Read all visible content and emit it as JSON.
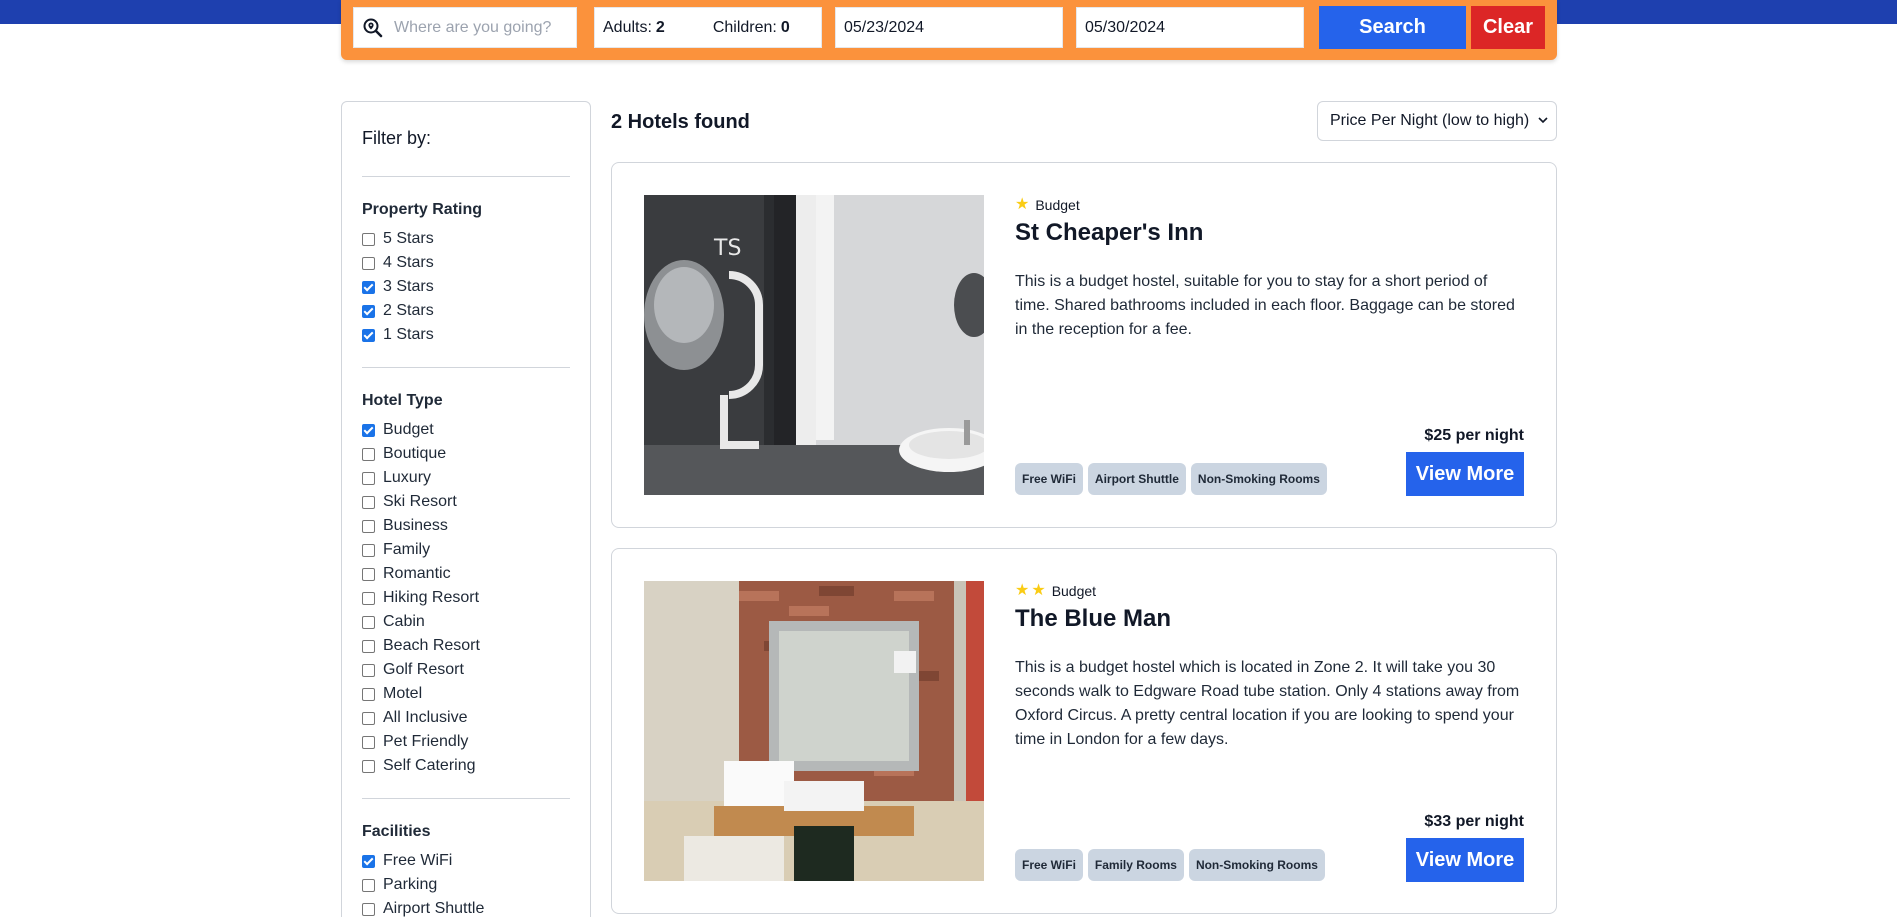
{
  "search": {
    "destination_placeholder": "Where are you going?",
    "adults_label": "Adults:",
    "adults_value": "2",
    "children_label": "Children:",
    "children_value": "0",
    "checkin": "05/23/2024",
    "checkout": "05/30/2024",
    "search_label": "Search",
    "clear_label": "Clear"
  },
  "filters": {
    "title": "Filter by:",
    "property_rating": {
      "title": "Property Rating",
      "options": [
        {
          "label": "5 Stars",
          "checked": false
        },
        {
          "label": "4 Stars",
          "checked": false
        },
        {
          "label": "3 Stars",
          "checked": true
        },
        {
          "label": "2 Stars",
          "checked": true
        },
        {
          "label": "1 Stars",
          "checked": true
        }
      ]
    },
    "hotel_type": {
      "title": "Hotel Type",
      "options": [
        {
          "label": "Budget",
          "checked": true
        },
        {
          "label": "Boutique",
          "checked": false
        },
        {
          "label": "Luxury",
          "checked": false
        },
        {
          "label": "Ski Resort",
          "checked": false
        },
        {
          "label": "Business",
          "checked": false
        },
        {
          "label": "Family",
          "checked": false
        },
        {
          "label": "Romantic",
          "checked": false
        },
        {
          "label": "Hiking Resort",
          "checked": false
        },
        {
          "label": "Cabin",
          "checked": false
        },
        {
          "label": "Beach Resort",
          "checked": false
        },
        {
          "label": "Golf Resort",
          "checked": false
        },
        {
          "label": "Motel",
          "checked": false
        },
        {
          "label": "All Inclusive",
          "checked": false
        },
        {
          "label": "Pet Friendly",
          "checked": false
        },
        {
          "label": "Self Catering",
          "checked": false
        }
      ]
    },
    "facilities": {
      "title": "Facilities",
      "options": [
        {
          "label": "Free WiFi",
          "checked": true
        },
        {
          "label": "Parking",
          "checked": false
        },
        {
          "label": "Airport Shuttle",
          "checked": false
        }
      ]
    }
  },
  "results": {
    "count_text": "2 Hotels found",
    "sort_value": "Price Per Night (low to high)",
    "hotels": [
      {
        "stars": 1,
        "type": "Budget",
        "name": "St Cheaper's Inn",
        "description": "This is a budget hostel, suitable for you to stay for a short period of time. Shared bathrooms included in each floor. Baggage can be stored in the reception for a fee.",
        "facilities": [
          "Free WiFi",
          "Airport Shuttle",
          "Non-Smoking Rooms"
        ],
        "price": "$25 per night",
        "button": "View More"
      },
      {
        "stars": 2,
        "type": "Budget",
        "name": "The Blue Man",
        "description": "This is a budget hostel which is located in Zone 2. It will take you 30 seconds walk to Edgware Road tube station. Only 4 stations away from Oxford Circus. A pretty central location if you are looking to spend your time in London for a few days.",
        "facilities": [
          "Free WiFi",
          "Family Rooms",
          "Non-Smoking Rooms"
        ],
        "price": "$33 per night",
        "button": "View More"
      }
    ]
  },
  "colors": {
    "topbar": "#1e40af",
    "searchbar": "#fb923c",
    "primary": "#2563eb",
    "danger": "#dc2626",
    "star": "#facc15"
  }
}
